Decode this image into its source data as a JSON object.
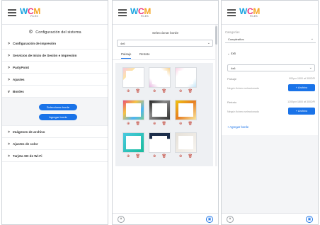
{
  "logo": {
    "w": "W",
    "c": "C",
    "m": "M",
    "tiny": "FILES"
  },
  "screen1": {
    "title": "Configuración del sistema",
    "items": [
      {
        "label": "Configuración de impresión",
        "chevron": ">"
      },
      {
        "label": "Servicios de Inicio de Sesión e Impresión",
        "chevron": ">"
      },
      {
        "label": "PartyPoint",
        "chevron": ">"
      },
      {
        "label": "Ajustes",
        "chevron": ">"
      },
      {
        "label": "Bordes",
        "chevron": "v"
      }
    ],
    "items_after": [
      {
        "label": "Imágenes de archivo",
        "chevron": ">"
      },
      {
        "label": "Ajustes de color",
        "chevron": ">"
      },
      {
        "label": "Tarjeta SD de Wi-Fi",
        "chevron": ">"
      }
    ],
    "select_border_btn": "Seleccionar borde",
    "add_border_btn": "Agregar borde"
  },
  "screen2": {
    "title": "Seleccionar borde",
    "size_value": "4x6",
    "tabs": [
      "Paisaje",
      "Retrato"
    ],
    "close_icon": "×",
    "save_icon": "▣"
  },
  "screen3": {
    "category_label": "Categorías",
    "category_value": "Cumpleaños",
    "section": "4x6",
    "size_value": "4x6",
    "landscape_label": "Paisaje",
    "landscape_spec": "900px×1500 at 300DPI",
    "portrait_label": "Retrato",
    "portrait_spec": "1200px×1800 at 300DPI",
    "no_file": "Ningún fichero seleccionado",
    "archive_btn": "+ Archivo",
    "add_border_link": "+ Agregar borde",
    "close_icon": "×",
    "save_icon": "▣"
  },
  "colors": {
    "accent": "#1a73e8"
  }
}
